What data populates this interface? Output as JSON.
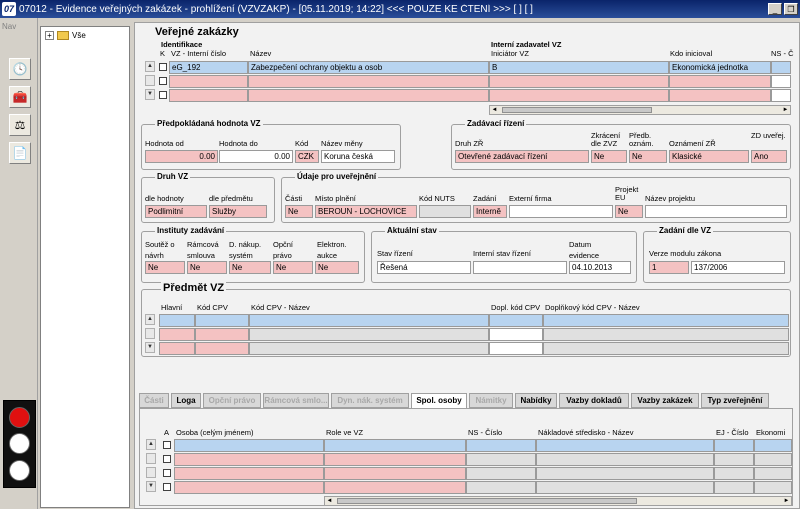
{
  "window": {
    "title": "07012 - Evidence veřejných zakázek - prohlížení (VZVZAKP) - [05.11.2019; 14:22] <<< POUZE KE ČTENÍ >>> [ ] [ ]",
    "app_icon": "07"
  },
  "nav": {
    "label": "Nav"
  },
  "tree": {
    "root": "Vše"
  },
  "vz": {
    "title": "Veřejné zakázky",
    "hdr_identifikace": "Identifikace",
    "hdr_interni": "Interní zadavatel VZ",
    "col_k": "K",
    "col_vz": "VZ - Interní číslo",
    "col_nazev": "Název",
    "col_iniciator": "Iniciátor VZ",
    "col_kdo": "Kdo inicioval",
    "col_ns": "NS - Č",
    "rows": [
      {
        "vz": "eG_192",
        "nazev": "Zabezpečení ochrany objektu a osob",
        "iniciator": "B",
        "kdo": "Ekonomická jednotka"
      }
    ]
  },
  "hodnota": {
    "title": "Předpokládaná hodnota VZ",
    "od_label": "Hodnota od",
    "do_label": "Hodnota do",
    "kod_label": "Kód",
    "mena_label": "Název měny",
    "od": "0.00",
    "do": "0.00",
    "kod": "CZK",
    "mena": "Koruna česká"
  },
  "zadavaci": {
    "title": "Zadávací řízení",
    "druh_label": "Druh ZŘ",
    "zkraceni_label": "Zkrácení dle ZVZ",
    "predb_label": "Předb. oznám.",
    "oznameni_label": "Oznámení ZŘ",
    "zd_label": "ZD uveřej.",
    "druh": "Otevřené zadávací řízení",
    "zkraceni": "Ne",
    "predb": "Ne",
    "oznameni": "Klasické",
    "zd": "Ano"
  },
  "druh": {
    "title": "Druh VZ",
    "hodnoty_label": "dle hodnoty",
    "predmetu_label": "dle předmětu",
    "hodnoty": "Podlimitní",
    "predmetu": "Služby"
  },
  "udaje": {
    "title": "Údaje pro uveřejnění",
    "casti_label": "Části",
    "misto_label": "Místo plnění",
    "nuts_label": "Kód NUTS",
    "zadani_label": "Zadání",
    "firma_label": "Externí firma",
    "projekt_label": "Projekt EU",
    "nazev_projektu_label": "Název projektu",
    "casti": "Ne",
    "misto": "BEROUN - LOCHOVICE",
    "zadani": "Interně",
    "projekt": "Ne"
  },
  "instituty": {
    "title": "Instituty zadávání",
    "soutez_label": "Soutěž o návrh",
    "ramcova_label": "Rámcová smlouva",
    "dnakup_label": "D. nákup. systém",
    "opcni_label": "Opční právo",
    "elektron_label": "Elektron. aukce",
    "soutez": "Ne",
    "ramcova": "Ne",
    "dnakup": "Ne",
    "opcni": "Ne",
    "elektron": "Ne"
  },
  "stav": {
    "title": "Aktuální stav",
    "stav_label": "Stav řízení",
    "interni_label": "Interní stav řízení",
    "datum_label": "Datum evidence",
    "stav": "Řešená",
    "datum": "04.10.2013"
  },
  "zadani_vz": {
    "title": "Zadání dle VZ",
    "verze_label": "Verze modulu zákona",
    "verze": "1",
    "zakon": "137/2006"
  },
  "predmet": {
    "title": "Předmět VZ",
    "col_hlavni": "Hlavní",
    "col_kod": "Kód CPV",
    "col_nazev": "Kód CPV - Název",
    "col_dopl": "Dopl. kód CPV",
    "col_dopl_nazev": "Doplňkový kód CPV - Název"
  },
  "tabs": [
    {
      "label": "Části",
      "state": "dis"
    },
    {
      "label": "Loga",
      "state": ""
    },
    {
      "label": "Opční právo",
      "state": "dis"
    },
    {
      "label": "Rámcová smlo...",
      "state": "dis"
    },
    {
      "label": "Dyn. nák. systém",
      "state": "dis"
    },
    {
      "label": "Spol. osoby",
      "state": "active"
    },
    {
      "label": "Námitky",
      "state": "dis"
    },
    {
      "label": "Nabídky",
      "state": ""
    },
    {
      "label": "Vazby dokladů",
      "state": ""
    },
    {
      "label": "Vazby zakázek",
      "state": ""
    },
    {
      "label": "Typ zveřejnění",
      "state": ""
    }
  ],
  "osoby": {
    "col_a": "A",
    "col_osoba": "Osoba (celým jménem)",
    "col_role": "Role ve VZ",
    "col_ns": "NS - Číslo",
    "col_nakl": "Nákladové středisko - Název",
    "col_ej": "EJ - Číslo",
    "col_ekon": "Ekonomi"
  },
  "icons": {
    "expand": "+",
    "up": "▲",
    "down": "▼",
    "left": "◄",
    "right": "►",
    "minimize": "_",
    "restore": "❐",
    "clock": "🕓",
    "toolbox": "🧰",
    "scales": "⚖",
    "document": "📄"
  }
}
